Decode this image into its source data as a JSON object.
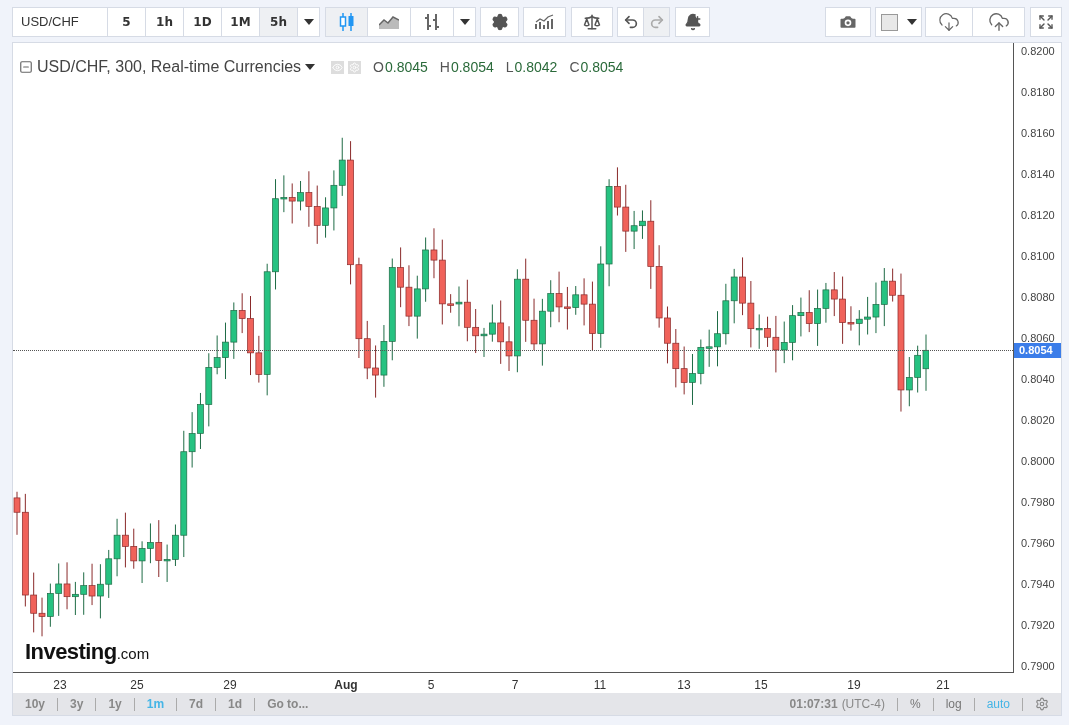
{
  "toolbar": {
    "symbol": "USD/CHF",
    "intervals": [
      {
        "label": "5",
        "selected": false
      },
      {
        "label": "1h",
        "selected": false
      },
      {
        "label": "1D",
        "selected": false
      },
      {
        "label": "1M",
        "selected": false
      },
      {
        "label": "5h",
        "selected": true
      }
    ],
    "chart_types": [
      {
        "kind": "candles",
        "selected": true
      },
      {
        "kind": "area",
        "selected": false
      },
      {
        "kind": "bars",
        "selected": false
      }
    ],
    "undo": {
      "disabled": false
    },
    "redo": {
      "disabled": true
    }
  },
  "legend": {
    "title": "USD/CHF, 300, Real-time Currencies",
    "ohlc": [
      {
        "label": "O",
        "value": "0.8045"
      },
      {
        "label": "H",
        "value": "0.8054"
      },
      {
        "label": "L",
        "value": "0.8042"
      },
      {
        "label": "C",
        "value": "0.8054"
      }
    ]
  },
  "logo": {
    "name": "Investing",
    "suffix": ".com"
  },
  "price_axis": {
    "labels": [
      "0.8200",
      "0.8180",
      "0.8160",
      "0.8140",
      "0.8120",
      "0.8100",
      "0.8080",
      "0.8060",
      "0.8040",
      "0.8020",
      "0.8000",
      "0.7980",
      "0.7960",
      "0.7940",
      "0.7920",
      "0.7900"
    ],
    "current": "0.8054"
  },
  "time_axis": {
    "labels": [
      {
        "label": "23",
        "bold": false
      },
      {
        "label": "25",
        "bold": false
      },
      {
        "label": "29",
        "bold": false
      },
      {
        "label": "Aug",
        "bold": true
      },
      {
        "label": "5",
        "bold": false
      },
      {
        "label": "7",
        "bold": false
      },
      {
        "label": "11",
        "bold": false
      },
      {
        "label": "13",
        "bold": false
      },
      {
        "label": "15",
        "bold": false
      },
      {
        "label": "19",
        "bold": false
      },
      {
        "label": "21",
        "bold": false
      }
    ]
  },
  "bottom_bar": {
    "ranges": [
      {
        "label": "10y",
        "selected": false
      },
      {
        "label": "3y",
        "selected": false
      },
      {
        "label": "1y",
        "selected": false
      },
      {
        "label": "1m",
        "selected": true
      },
      {
        "label": "7d",
        "selected": false
      },
      {
        "label": "1d",
        "selected": false
      }
    ],
    "goto": "Go to...",
    "time": "01:07:31",
    "timezone": "(UTC-4)",
    "options": [
      {
        "label": "%",
        "selected": false
      },
      {
        "label": "log",
        "selected": false
      },
      {
        "label": "auto",
        "selected": true
      }
    ]
  }
}
